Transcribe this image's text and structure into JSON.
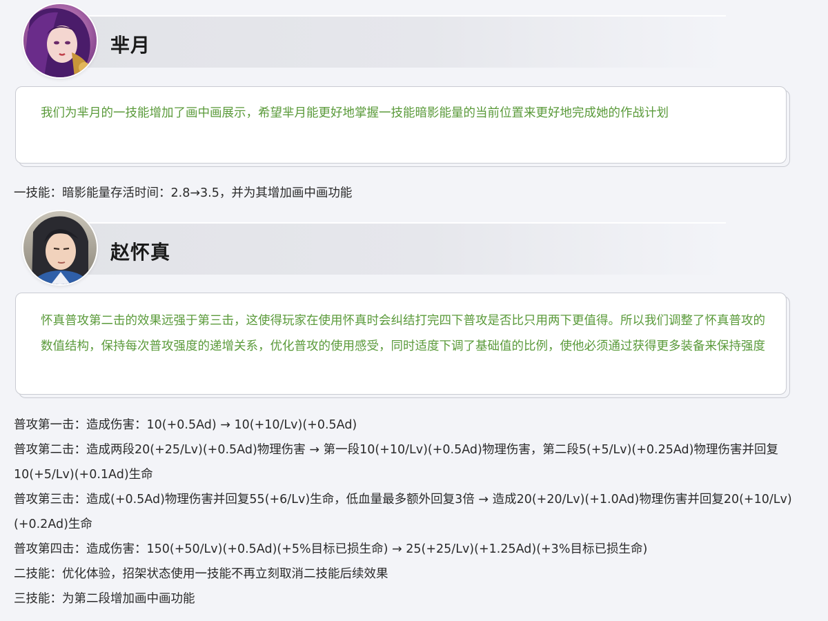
{
  "heroes": [
    {
      "name": "芈月",
      "note": "我们为芈月的一技能增加了画中画展示，希望芈月能更好地掌握一技能暗影能量的当前位置来更好地完成她的作战计划",
      "changes": [
        "一技能：暗影能量存活时间：2.8→3.5，并为其增加画中画功能"
      ]
    },
    {
      "name": "赵怀真",
      "note": "怀真普攻第二击的效果远强于第三击，这使得玩家在使用怀真时会纠结打完四下普攻是否比只用两下更值得。所以我们调整了怀真普攻的数值结构，保持每次普攻强度的递增关系，优化普攻的使用感受，同时适度下调了基础值的比例，使他必须通过获得更多装备来保持强度",
      "changes": [
        "普攻第一击：造成伤害：10(+0.5Ad) → 10(+10/Lv)(+0.5Ad)",
        "普攻第二击：造成两段20(+25/Lv)(+0.5Ad)物理伤害 → 第一段10(+10/Lv)(+0.5Ad)物理伤害，第二段5(+5/Lv)(+0.25Ad)物理伤害并回复10(+5/Lv)(+0.1Ad)生命",
        "普攻第三击：造成(+0.5Ad)物理伤害并回复55(+6/Lv)生命，低血量最多额外回复3倍 → 造成20(+20/Lv)(+1.0Ad)物理伤害并回复20(+10/Lv)(+0.2Ad)生命",
        "普攻第四击：造成伤害：150(+50/Lv)(+0.5Ad)(+5%目标已损生命) → 25(+25/Lv)(+1.25Ad)(+3%目标已损生命)",
        "二技能：优化体验，招架状态使用一技能不再立刻取消二技能后续效果",
        "三技能：为第二段增加画中画功能"
      ]
    }
  ],
  "colors": {
    "note_text": "#5a9a3a",
    "body_text": "#2a2a2a",
    "page_bg": "#f3f4f8"
  }
}
